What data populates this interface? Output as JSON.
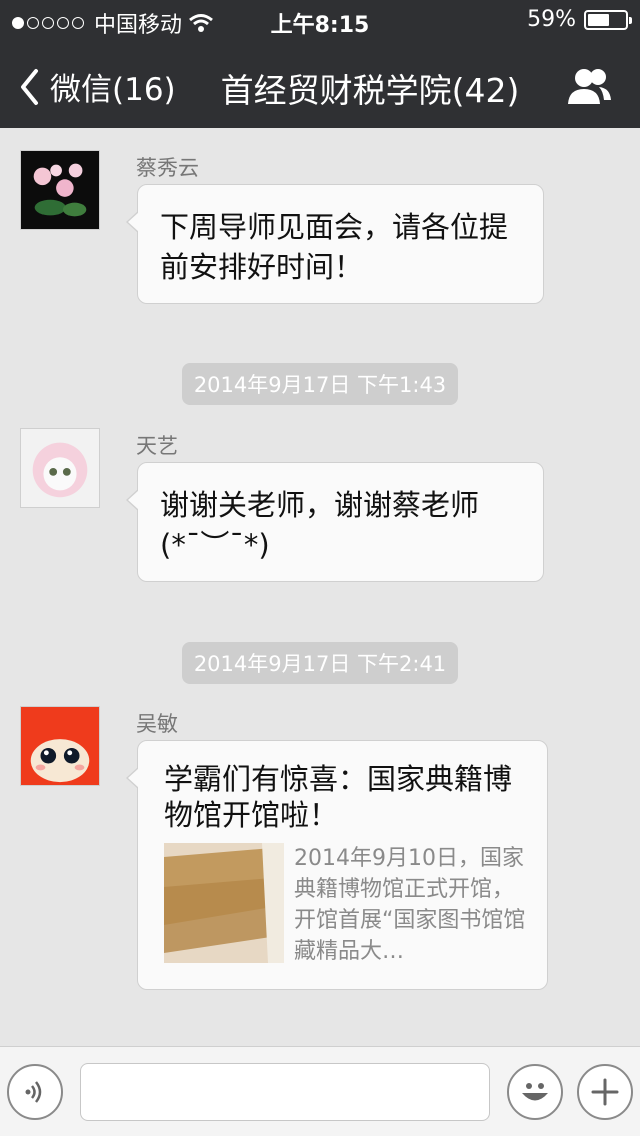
{
  "status_bar": {
    "carrier": "中国移动",
    "time": "上午8:15",
    "battery_percent": 59,
    "battery_label": "59%"
  },
  "nav": {
    "back_label": "微信(16)",
    "title": "首经贸财税学院(42)"
  },
  "messages": [
    {
      "sender": "蔡秀云",
      "text": "下周导师见面会，请各位提前安排好时间！"
    },
    {
      "sender": "天艺",
      "text": "谢谢关老师，谢谢蔡老师(*¯︶¯*)"
    },
    {
      "sender": "吴敏",
      "card": {
        "title": "学霸们有惊喜：国家典籍博物馆开馆啦！",
        "summary": "2014年9月10日，国家典籍博物馆正式开馆，开馆首展“国家图书馆馆藏精品大…"
      }
    }
  ],
  "timestamps": [
    "2014年9月17日 下午1:43",
    "2014年9月17日 下午2:41"
  ],
  "composer": {
    "placeholder": ""
  },
  "icons": {
    "voice": "voice-icon",
    "emoji": "emoji-icon",
    "plus": "plus-icon",
    "back": "chevron-left-icon",
    "group": "group-members-icon"
  }
}
